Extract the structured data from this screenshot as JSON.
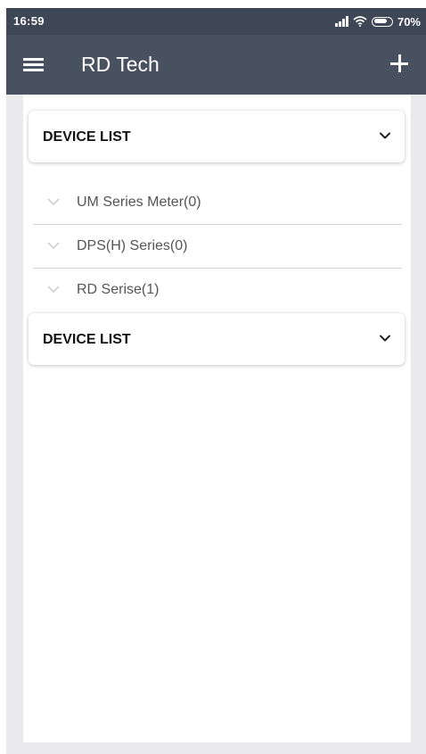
{
  "status_bar": {
    "time": "16:59",
    "battery_percent": "70%"
  },
  "app_bar": {
    "title": "RD Tech",
    "menu_icon": "hamburger-menu-icon",
    "add_icon": "plus-icon"
  },
  "device_lists": [
    {
      "title": "DEVICE LIST",
      "expanded": true,
      "items": [
        {
          "label": "UM Series Meter(0)"
        },
        {
          "label": "DPS(H) Series(0)"
        },
        {
          "label": "RD Serise(1)"
        }
      ]
    },
    {
      "title": "DEVICE LIST",
      "expanded": false,
      "items": []
    }
  ],
  "colors": {
    "app_bar": "#475160",
    "status_bar": "#3e4755",
    "background": "#eaeaed",
    "panel": "#ffffff"
  }
}
